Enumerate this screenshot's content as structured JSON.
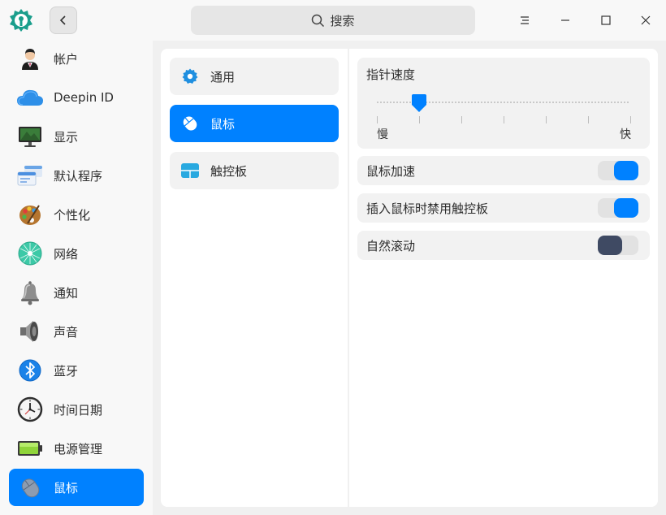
{
  "header": {
    "search_placeholder": "搜索"
  },
  "sidebar": {
    "items": [
      {
        "label": "帐户",
        "icon": "account-icon"
      },
      {
        "label": "Deepin ID",
        "icon": "cloud-icon"
      },
      {
        "label": "显示",
        "icon": "display-icon"
      },
      {
        "label": "默认程序",
        "icon": "default-apps-icon"
      },
      {
        "label": "个性化",
        "icon": "personalization-icon"
      },
      {
        "label": "网络",
        "icon": "network-icon"
      },
      {
        "label": "通知",
        "icon": "bell-icon"
      },
      {
        "label": "声音",
        "icon": "speaker-icon"
      },
      {
        "label": "蓝牙",
        "icon": "bluetooth-icon"
      },
      {
        "label": "时间日期",
        "icon": "clock-icon"
      },
      {
        "label": "电源管理",
        "icon": "battery-icon"
      },
      {
        "label": "鼠标",
        "icon": "mouse-icon"
      }
    ],
    "active": "鼠标"
  },
  "subnav": {
    "items": [
      {
        "label": "通用",
        "icon": "gear-icon"
      },
      {
        "label": "鼠标",
        "icon": "mouse-icon"
      },
      {
        "label": "触控板",
        "icon": "touchpad-icon"
      }
    ],
    "active": "鼠标"
  },
  "settings": {
    "pointer_speed": {
      "title": "指针速度",
      "min_label": "慢",
      "max_label": "快",
      "value_fraction": 0.167,
      "steps": 7
    },
    "toggles": [
      {
        "label": "鼠标加速",
        "state": "on"
      },
      {
        "label": "插入鼠标时禁用触控板",
        "state": "on"
      },
      {
        "label": "自然滚动",
        "state": "off"
      }
    ]
  },
  "colors": {
    "accent": "#0081ff",
    "toggle_off_knob": "#3f4a63"
  }
}
